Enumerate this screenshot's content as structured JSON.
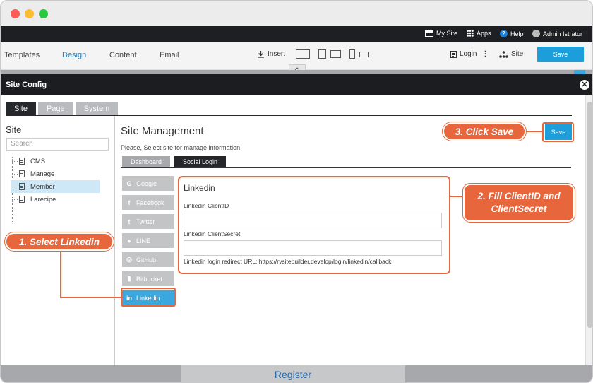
{
  "adminbar": {
    "my_site": "My Site",
    "apps": "Apps",
    "help": "Help",
    "user": "Admin Istrator"
  },
  "menubar": {
    "tabs": [
      "Templates",
      "Design",
      "Content",
      "Email"
    ],
    "active_tab": "Design",
    "insert": "Insert",
    "login": "Login",
    "site": "Site",
    "save": "Save"
  },
  "modal": {
    "title": "Site Config",
    "close_glyph": "✕",
    "tabs": [
      "Site",
      "Page",
      "System"
    ],
    "active_tab": "Site"
  },
  "sidebar": {
    "heading": "Site",
    "search_placeholder": "Search",
    "items": [
      {
        "label": "CMS",
        "selected": false
      },
      {
        "label": "Manage",
        "selected": false
      },
      {
        "label": "Member",
        "selected": true
      },
      {
        "label": "Larecipe",
        "selected": false
      }
    ]
  },
  "main": {
    "heading": "Site Management",
    "description": "Please, Select site for manage information.",
    "sub_tabs": [
      "Dashboard",
      "Social Login"
    ],
    "active_sub_tab": "Social Login",
    "providers": [
      {
        "icon": "G",
        "label": "Google",
        "active": false
      },
      {
        "icon": "f",
        "label": "Facebook",
        "active": false
      },
      {
        "icon": "t",
        "label": "Twitter",
        "active": false
      },
      {
        "icon": "●",
        "label": "LINE",
        "active": false
      },
      {
        "icon": "◎",
        "label": "GitHub",
        "active": false
      },
      {
        "icon": "▮",
        "label": "Bitbucket",
        "active": false
      },
      {
        "icon": "in",
        "label": "Linkedin",
        "active": true
      }
    ],
    "panel": {
      "title": "Linkedin",
      "client_id_label": "Linkedin ClientID",
      "client_id_value": "",
      "client_secret_label": "Linkedin ClientSecret",
      "client_secret_value": "",
      "redirect_text": "Linkedin login redirect URL: https://rvsitebuilder.develop/login/linkedin/callback"
    },
    "save": "Save"
  },
  "callouts": {
    "step1": "1. Select  Linkedin",
    "step2_line1": "2. Fill ClientID and",
    "step2_line2": "ClientSecret",
    "step3": "3. Click Save"
  },
  "footer": {
    "label": "Register"
  },
  "colors": {
    "accent": "#1b9ed9",
    "callout": "#e8663b",
    "dark": "#1c1d20"
  }
}
